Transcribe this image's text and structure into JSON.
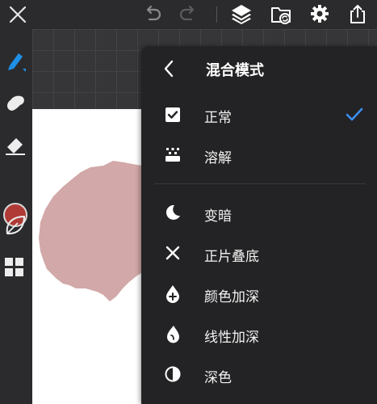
{
  "top_bar": {
    "close_icon": "close-icon",
    "undo_icon": "undo-icon",
    "redo_icon": "redo-icon",
    "layers_icon": "layers-icon",
    "gallery_icon": "gallery-icon",
    "settings_icon": "settings-icon",
    "share_icon": "share-icon"
  },
  "toolbar": {
    "tools": [
      "brush-icon",
      "smudge-icon",
      "eraser-icon",
      "leaf-icon",
      "grid-icon"
    ],
    "current_color": "#b03a35"
  },
  "canvas": {
    "paper_color": "#ffffff",
    "shape_color": "#d2a8a8"
  },
  "blend_menu": {
    "back_icon": "back-chevron-icon",
    "title": "混合模式",
    "accent_color": "#3a8ff0",
    "items": [
      {
        "label": "正常",
        "icon": "checkbox-icon",
        "selected": true
      },
      {
        "label": "溶解",
        "icon": "dissolve-icon",
        "selected": false
      },
      {
        "label": "变暗",
        "icon": "moon-icon",
        "selected": false
      },
      {
        "label": "正片叠底",
        "icon": "multiply-icon",
        "selected": false
      },
      {
        "label": "颜色加深",
        "icon": "drop-plus-icon",
        "selected": false
      },
      {
        "label": "线性加深",
        "icon": "leaf-drop-icon",
        "selected": false
      },
      {
        "label": "深色",
        "icon": "half-circle-icon",
        "selected": false
      }
    ]
  }
}
